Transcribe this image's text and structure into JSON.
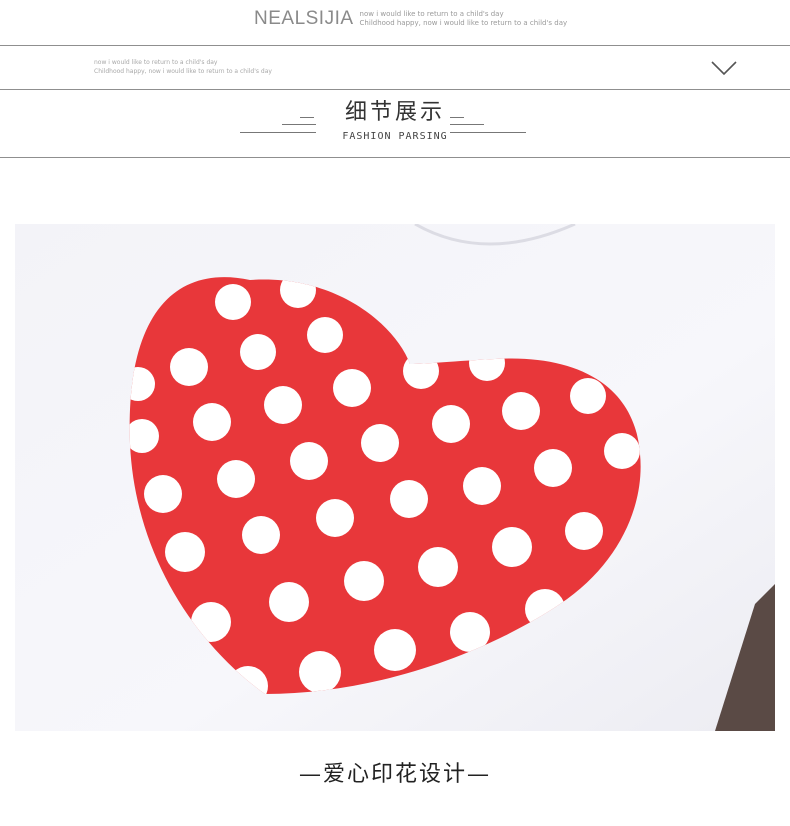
{
  "header": {
    "brand": "NEALSIJIA",
    "tagline_1": "now i would like to return to a child's day",
    "tagline_2": "Childhood happy, now i would like to return to a child's day"
  },
  "sub_header": {
    "line_1": "now i would like to return to a child's day",
    "line_2": "Childhood happy, now i would like to return to a child's day",
    "chevron_icon": "chevron-down-icon"
  },
  "section": {
    "title": "细节展示",
    "subtitle": "FASHION PARSING"
  },
  "photo": {
    "icon": "polka-dot-heart-print",
    "heart_color": "#e8373a",
    "dot_color": "#ffffff"
  },
  "caption": {
    "text": "—爱心印花设计—"
  }
}
